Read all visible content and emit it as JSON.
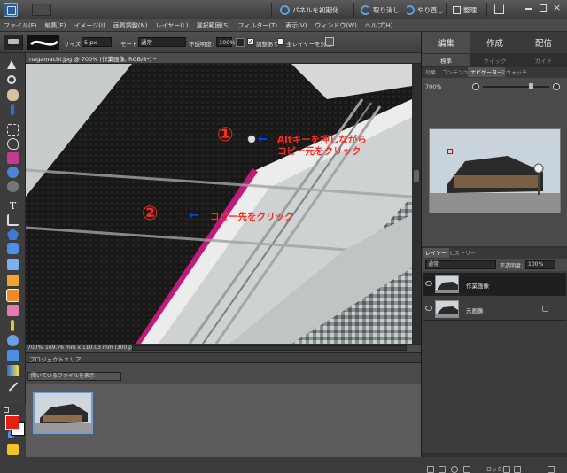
{
  "topbar": {
    "reset_panels": "パネルを初期化",
    "undo": "取り消し",
    "redo": "やり直し",
    "organize": "整理"
  },
  "menu": [
    "ファイル(F)",
    "編集(E)",
    "イメージ(I)",
    "画質調整(N)",
    "レイヤー(L)",
    "選択範囲(S)",
    "フィルター(T)",
    "表示(V)",
    "ウィンドウ(W)",
    "ヘルプ(H)"
  ],
  "options": {
    "size_label": "サイズ:",
    "size_value": "5 px",
    "mode_label": "モード:",
    "mode_value": "通常",
    "opacity_label": "不透明度:",
    "opacity_value": "100%",
    "aligned_label": "調整あり",
    "all_layers_label": "全レイヤーを対象"
  },
  "document": {
    "tab_title": "nagamachi.jpg @ 700% (作業画像, RGB/8*) *",
    "zoom": "700%",
    "info": "169.76 mm x 110.03 mm (300 ppi)"
  },
  "annotations": {
    "step1_num": "①",
    "step1_line1": "Altキーを押しながら",
    "step1_line2": "コピー元をクリック",
    "step2_num": "②",
    "step2_text": "コピー先をクリック"
  },
  "project": {
    "header": "プロジェクトエリア",
    "select_value": "開いているファイルを表示"
  },
  "panel": {
    "tabs": [
      "編集",
      "作成",
      "配信"
    ],
    "subtabs": [
      "標準",
      "クイック",
      "ガイド"
    ],
    "bin_tabs": [
      "効果",
      "コンテンツ",
      "ナビゲーター",
      "スウォッチ"
    ],
    "nav_zoom": "700%",
    "layer_tabs": [
      "レイヤー",
      "ヒストリー"
    ],
    "blend_mode": "通常",
    "opacity_label": "不透明度:",
    "opacity_value": "100%",
    "layers": [
      "作業画像",
      "元画像"
    ],
    "lock_label": "ロック:"
  },
  "colors": {
    "accent_blue": "#5aa0e6",
    "annotation_red": "#ff2a1a",
    "annotation_arrow": "#1040ff",
    "foreground": "#e81e12"
  }
}
